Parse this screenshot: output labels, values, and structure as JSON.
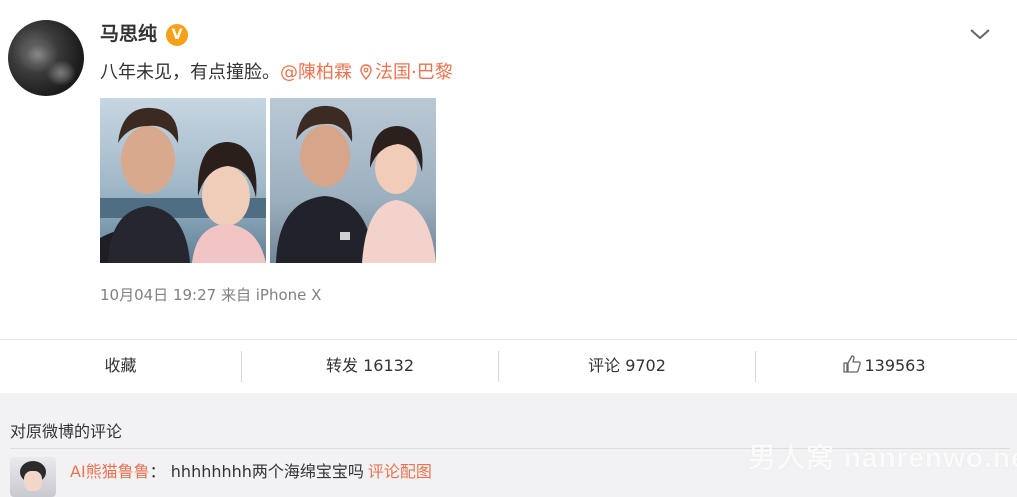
{
  "post": {
    "username": "马思纯",
    "verified_badge": "V",
    "text": "八年未见，有点撞脸。",
    "mention": "@陳柏霖",
    "location": "法国·巴黎",
    "timestamp": "10月04日 19:27",
    "source_prefix": "来自",
    "source": "iPhone X",
    "icons": {
      "more": "chevron-down-icon",
      "location": "location-pin-icon",
      "verified": "verified-v-icon"
    }
  },
  "actions": {
    "favorite": "收藏",
    "repost_label": "转发",
    "repost_count": "16132",
    "comment_label": "评论",
    "comment_count": "9702",
    "like_count": "139563",
    "like_icon": "thumbs-up-icon"
  },
  "comments": {
    "title": "对原微博的评论",
    "items": [
      {
        "user": "AI熊猫鲁鲁",
        "separator": "：",
        "text": "hhhhhhhh两个海绵宝宝吗",
        "pic_link": "评论配图"
      }
    ]
  },
  "watermark": "男人窝 nanrenwo.net",
  "colors": {
    "accent": "#eb7350",
    "badge": "#f7a018",
    "meta_text": "#808080",
    "comments_bg": "#f2f2f5"
  }
}
